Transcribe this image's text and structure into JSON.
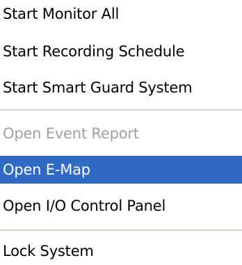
{
  "menu": {
    "items": [
      {
        "label": "Start Monitor All",
        "state": "normal"
      },
      {
        "label": "Start Recording Schedule",
        "state": "normal"
      },
      {
        "label": "Start Smart Guard System",
        "state": "normal"
      },
      {
        "label": "Open Event Report",
        "state": "disabled"
      },
      {
        "label": "Open E-Map",
        "state": "selected"
      },
      {
        "label": "Open I/O Control Panel",
        "state": "normal"
      },
      {
        "label": "Lock System",
        "state": "normal"
      }
    ]
  },
  "colors": {
    "selected_background": "#316ac5",
    "selected_text": "#ffffff",
    "disabled_text": "#a0a29a",
    "separator": "#d6d3c9"
  }
}
